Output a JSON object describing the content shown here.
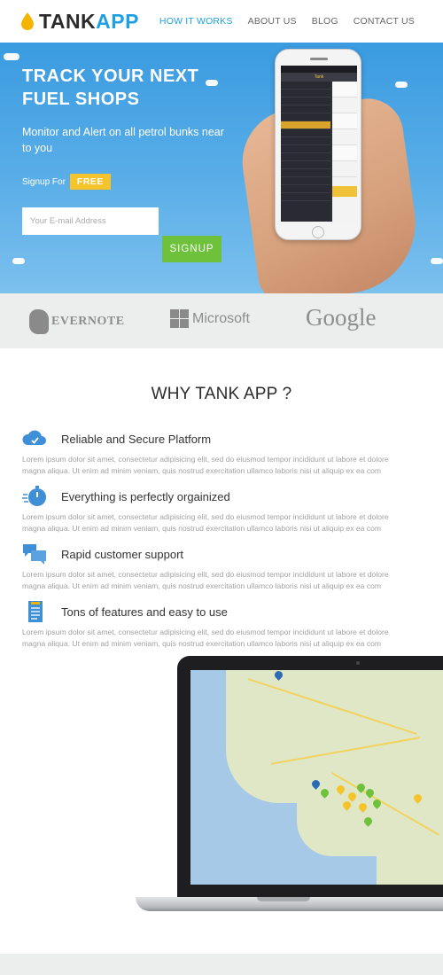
{
  "header": {
    "logo_tank": "TANK",
    "logo_app": "APP",
    "nav": [
      {
        "label": "HOW IT WORKS",
        "active": true
      },
      {
        "label": "ABOUT US",
        "active": false
      },
      {
        "label": "BLOG",
        "active": false
      },
      {
        "label": "CONTACT US",
        "active": false
      }
    ]
  },
  "hero": {
    "title": "TRACK YOUR NEXT FUEL SHOPS",
    "subtitle": "Monitor and Alert on all petrol bunks near to you",
    "signup_for_label": "Signup For",
    "free_badge": "FREE",
    "email_placeholder": "Your E-mail Address",
    "signup_button": "SIGNUP",
    "phone_app_title": "Tank"
  },
  "brands": {
    "evernote": "EVERNOTE",
    "microsoft": "Microsoft",
    "google": "Google"
  },
  "why": {
    "title": "WHY TANK APP ?",
    "features": [
      {
        "icon": "cloud-icon",
        "title": "Reliable and Secure Platform",
        "text": "Lorem ipsum dolor sit amet, consectetur adipisicing elit, sed do eiusmod tempor incididunt ut labore et dolore magna aliqua. Ut enim ad minim veniam, quis nostrud exercitation ullamco laboris nisi ut aliquip ex ea com"
      },
      {
        "icon": "stopwatch-icon",
        "title": "Everything is perfectly orgainized",
        "text": "Lorem ipsum dolor sit amet, consectetur adipisicing elit, sed do eiusmod tempor incididunt ut labore et dolore magna aliqua. Ut enim ad minim veniam, quis nostrud exercitation ullamco laboris nisi ut aliquip ex ea com"
      },
      {
        "icon": "chat-bubbles-icon",
        "title": "Rapid customer support",
        "text": "Lorem ipsum dolor sit amet, consectetur adipisicing elit, sed do eiusmod tempor incididunt ut labore et dolore magna aliqua. Ut enim ad minim veniam, quis nostrud exercitation ullamco laboris nisi ut aliquip ex ea com"
      },
      {
        "icon": "document-icon",
        "title": "Tons of features and easy to use",
        "text": "Lorem ipsum dolor sit amet, consectetur adipisicing elit, sed do eiusmod tempor incididunt ut labore et dolore magna aliqua. Ut enim ad minim veniam, quis nostrud exercitation ullamco laboris nisi ut aliquip ex ea com"
      }
    ]
  },
  "colors": {
    "accent": "#1ea0e3",
    "hero_bg": "#4aa6e5",
    "free_badge": "#f4c42a",
    "signup_button": "#6ec23b"
  }
}
